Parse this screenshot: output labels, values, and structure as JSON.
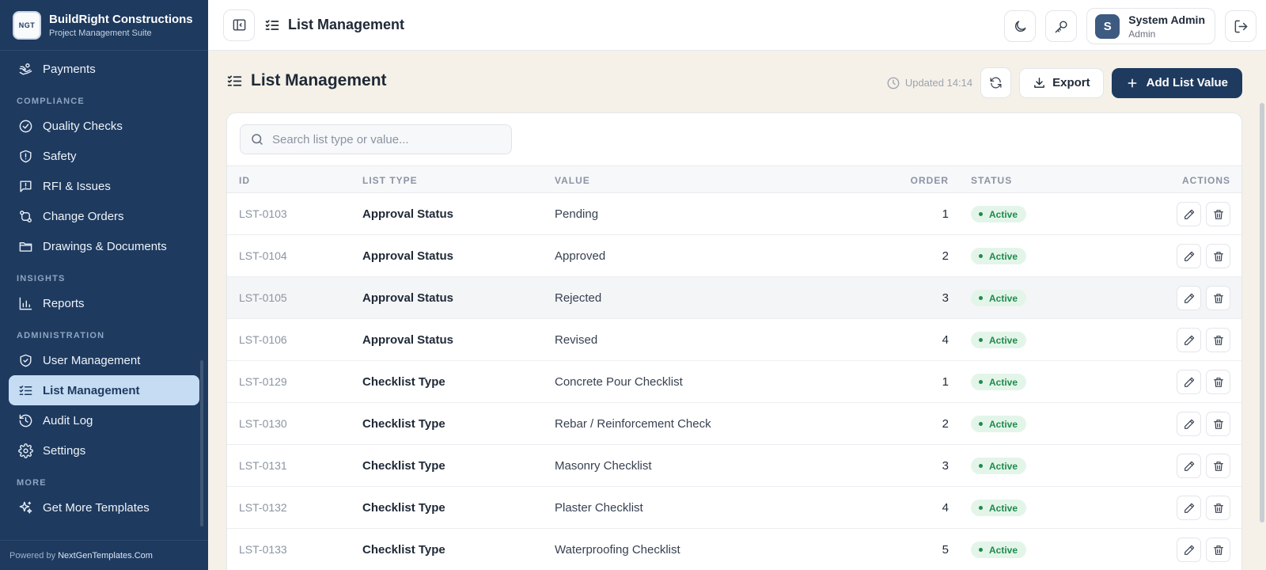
{
  "brand": {
    "logo_text": "NGT",
    "title": "BuildRight Constructions",
    "subtitle": "Project Management Suite"
  },
  "sidebar": {
    "payments": "Payments",
    "section_compliance": "COMPLIANCE",
    "quality": "Quality Checks",
    "safety": "Safety",
    "rfi": "RFI & Issues",
    "change_orders": "Change Orders",
    "drawings": "Drawings & Documents",
    "section_insights": "INSIGHTS",
    "reports": "Reports",
    "section_admin": "ADMINISTRATION",
    "user_mgmt": "User Management",
    "list_mgmt": "List Management",
    "audit": "Audit Log",
    "settings": "Settings",
    "section_more": "MORE",
    "templates": "Get More Templates",
    "footer_prefix": "Powered by",
    "footer_link": "NextGenTemplates.Com"
  },
  "topbar": {
    "title": "List Management",
    "user_initial": "S",
    "user_name": "System Admin",
    "user_role": "Admin"
  },
  "page": {
    "title": "List Management",
    "updated": "Updated 14:14",
    "export_label": "Export",
    "add_label": "Add List Value",
    "search_placeholder": "Search list type or value..."
  },
  "table": {
    "columns": {
      "id": "ID",
      "type": "LIST TYPE",
      "value": "VALUE",
      "order": "ORDER",
      "status": "STATUS",
      "actions": "ACTIONS"
    },
    "rows": [
      {
        "id": "LST-0103",
        "type": "Approval Status",
        "value": "Pending",
        "order": "1",
        "status": "Active"
      },
      {
        "id": "LST-0104",
        "type": "Approval Status",
        "value": "Approved",
        "order": "2",
        "status": "Active"
      },
      {
        "id": "LST-0105",
        "type": "Approval Status",
        "value": "Rejected",
        "order": "3",
        "status": "Active"
      },
      {
        "id": "LST-0106",
        "type": "Approval Status",
        "value": "Revised",
        "order": "4",
        "status": "Active"
      },
      {
        "id": "LST-0129",
        "type": "Checklist Type",
        "value": "Concrete Pour Checklist",
        "order": "1",
        "status": "Active"
      },
      {
        "id": "LST-0130",
        "type": "Checklist Type",
        "value": "Rebar / Reinforcement Check",
        "order": "2",
        "status": "Active"
      },
      {
        "id": "LST-0131",
        "type": "Checklist Type",
        "value": "Masonry Checklist",
        "order": "3",
        "status": "Active"
      },
      {
        "id": "LST-0132",
        "type": "Checklist Type",
        "value": "Plaster Checklist",
        "order": "4",
        "status": "Active"
      },
      {
        "id": "LST-0133",
        "type": "Checklist Type",
        "value": "Waterproofing Checklist",
        "order": "5",
        "status": "Active"
      }
    ]
  },
  "colors": {
    "sidebar_bg": "#1e3a5f",
    "active_nav_bg": "#c5dcf3",
    "primary": "#1e3a5f",
    "content_bg": "#f5f1e8",
    "status_active": "#1f8a4c"
  }
}
